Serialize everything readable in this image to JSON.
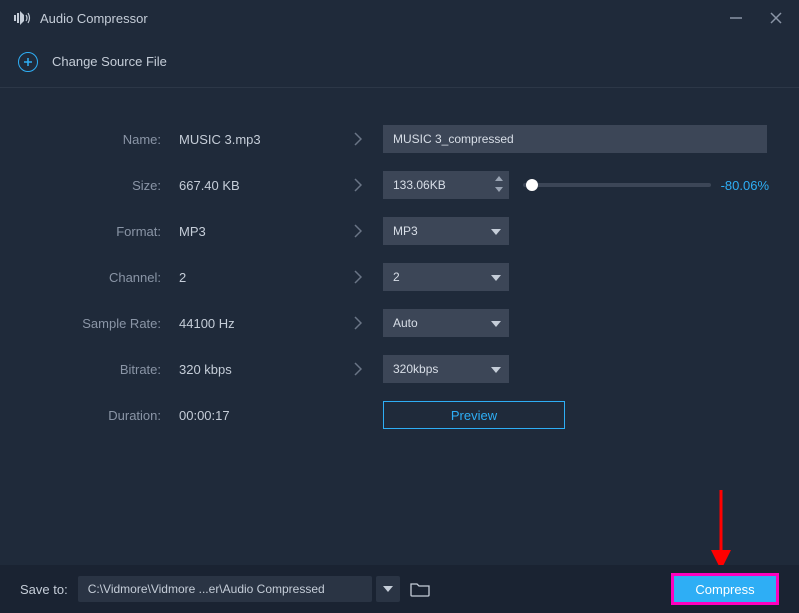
{
  "app_title": "Audio Compressor",
  "change_source_label": "Change Source File",
  "labels": {
    "name": "Name:",
    "size": "Size:",
    "format": "Format:",
    "channel": "Channel:",
    "sample_rate": "Sample Rate:",
    "bitrate": "Bitrate:",
    "duration": "Duration:"
  },
  "current": {
    "name": "MUSIC 3.mp3",
    "size": "667.40 KB",
    "format": "MP3",
    "channel": "2",
    "sample_rate": "44100 Hz",
    "bitrate": "320 kbps",
    "duration": "00:00:17"
  },
  "target": {
    "name": "MUSIC 3_compressed",
    "size": "133.06KB",
    "size_percent": "-80.06%",
    "slider_position_pct": 5,
    "format": "MP3",
    "channel": "2",
    "sample_rate": "Auto",
    "bitrate": "320kbps"
  },
  "preview_label": "Preview",
  "footer": {
    "save_to_label": "Save to:",
    "path": "C:\\Vidmore\\Vidmore ...er\\Audio Compressed",
    "compress_label": "Compress"
  }
}
